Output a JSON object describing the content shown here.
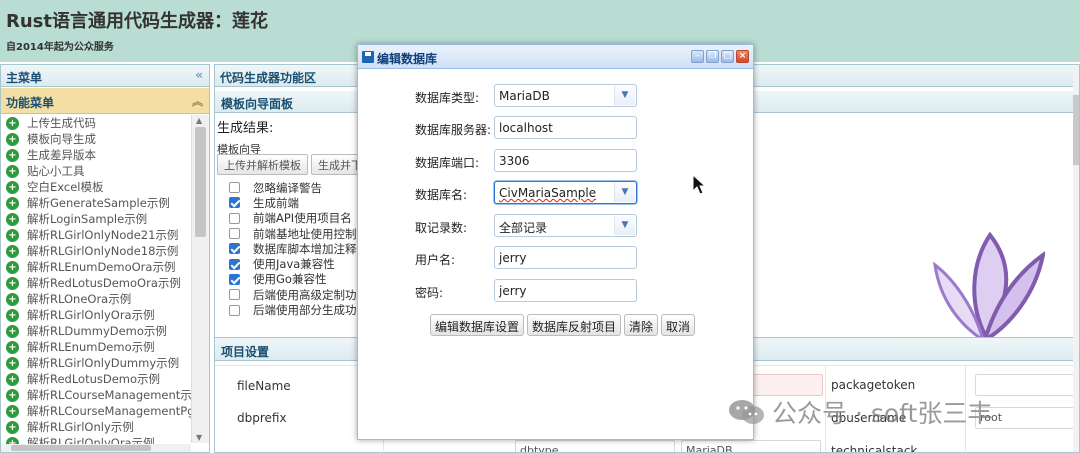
{
  "header": {
    "title": "Rust语言通用代码生成器：莲花",
    "subtitle": "自2014年起为公众服务"
  },
  "left_panel": {
    "title": "主菜单",
    "collapse_icon": "double-chevron-left-icon",
    "section_title": "功能菜单",
    "section_collapse_icon": "double-chevron-up-icon",
    "items": [
      "上传生成代码",
      "模板向导生成",
      "生成差异版本",
      "贴心小工具",
      "空白Excel模板",
      "解析GenerateSample示例",
      "解析LoginSample示例",
      "解析RLGirlOnlyNode21示例",
      "解析RLGirlOnlyNode18示例",
      "解析RLEnumDemoOra示例",
      "解析RedLotusDemoOra示例",
      "解析RLOneOra示例",
      "解析RLGirlOnlyOra示例",
      "解析RLDummyDemo示例",
      "解析RLEnumDemo示例",
      "解析RLGirlOnlyDummy示例",
      "解析RedLotusDemo示例",
      "解析RLCourseManagement示例",
      "解析RLCourseManagementPg示",
      "解析RLGirlOnly示例",
      "解析RLGirlOnlyOra示例"
    ]
  },
  "right_panel": {
    "title": "代码生成器功能区",
    "sub_title": "模板向导面板",
    "gen_result_label": "生成结果:",
    "wizard_label": "模板向导",
    "buttons": [
      "上传并解析模板",
      "生成并下"
    ],
    "options": [
      {
        "label": "忽略编译警告",
        "checked": false
      },
      {
        "label": "生成前端",
        "checked": true
      },
      {
        "label": "前端API使用项目名",
        "checked": false
      },
      {
        "label": "前端基地址使用控制",
        "checked": false
      },
      {
        "label": "数据库脚本增加注释",
        "checked": true
      },
      {
        "label": "使用Java兼容性",
        "checked": true
      },
      {
        "label": "使用Go兼容性",
        "checked": true
      },
      {
        "label": "后端使用高级定制功能",
        "checked": false
      },
      {
        "label": "后端使用部分生成功",
        "checked": false
      }
    ],
    "project_settings_title": "项目设置",
    "fields": {
      "filename_label": "fileName",
      "dbprefix_label": "dbprefix",
      "packagetoken_label": "packagetoken",
      "dbusername_label": "dbusername",
      "dbusername_value": "root",
      "row3_values": [
        "dbtype",
        "MariaDB",
        "technicalstack"
      ]
    }
  },
  "dialog": {
    "title": "编辑数据库",
    "tools": [
      "minimize-icon",
      "restore-icon",
      "maximize-icon",
      "close-icon"
    ],
    "fields": [
      {
        "label": "数据库类型:",
        "value": "MariaDB",
        "type": "select"
      },
      {
        "label": "数据库服务器:",
        "value": "localhost",
        "type": "text"
      },
      {
        "label": "数据库端口:",
        "value": "3306",
        "type": "text"
      },
      {
        "label": "数据库名:",
        "value": "CivMariaSample",
        "type": "select"
      },
      {
        "label": "取记录数:",
        "value": "全部记录",
        "type": "select"
      },
      {
        "label": "用户名:",
        "value": "jerry",
        "type": "text"
      },
      {
        "label": "密码:",
        "value": "jerry",
        "type": "text"
      }
    ],
    "buttons": [
      "编辑数据库设置",
      "数据库反射项目",
      "清除",
      "取消"
    ]
  },
  "watermark": {
    "text": "公众号 · soft张三丰",
    "icon": "wechat-icon"
  },
  "colors": {
    "header_bg": "#b9dcd3",
    "menu_section_bg": "#f3dfa3",
    "menu_icon": "#2f9a3e",
    "checkbox_on": "#2b73d5",
    "dialog_border": "#99bbe8"
  }
}
